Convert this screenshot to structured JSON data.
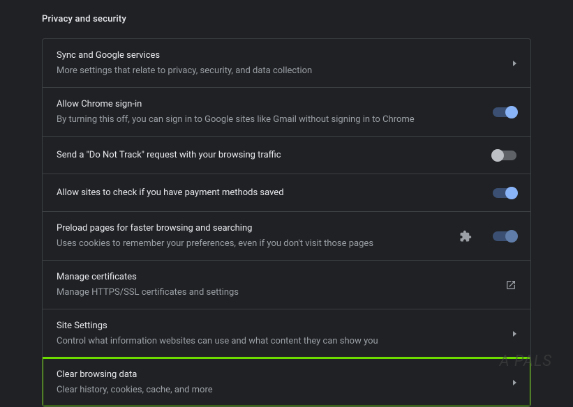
{
  "section": {
    "title": "Privacy and security"
  },
  "items": [
    {
      "title": "Sync and Google services",
      "sub": "More settings that relate to privacy, security, and data collection"
    },
    {
      "title": "Allow Chrome sign-in",
      "sub": "By turning this off, you can sign in to Google sites like Gmail without signing in to Chrome"
    },
    {
      "title": "Send a \"Do Not Track\" request with your browsing traffic"
    },
    {
      "title": "Allow sites to check if you have payment methods saved"
    },
    {
      "title": "Preload pages for faster browsing and searching",
      "sub": "Uses cookies to remember your preferences, even if you don't visit those pages"
    },
    {
      "title": "Manage certificates",
      "sub": "Manage HTTPS/SSL certificates and settings"
    },
    {
      "title": "Site Settings",
      "sub": "Control what information websites can use and what content they can show you"
    },
    {
      "title": "Clear browsing data",
      "sub": "Clear history, cookies, cache, and more"
    }
  ],
  "watermark": "A  PALS"
}
